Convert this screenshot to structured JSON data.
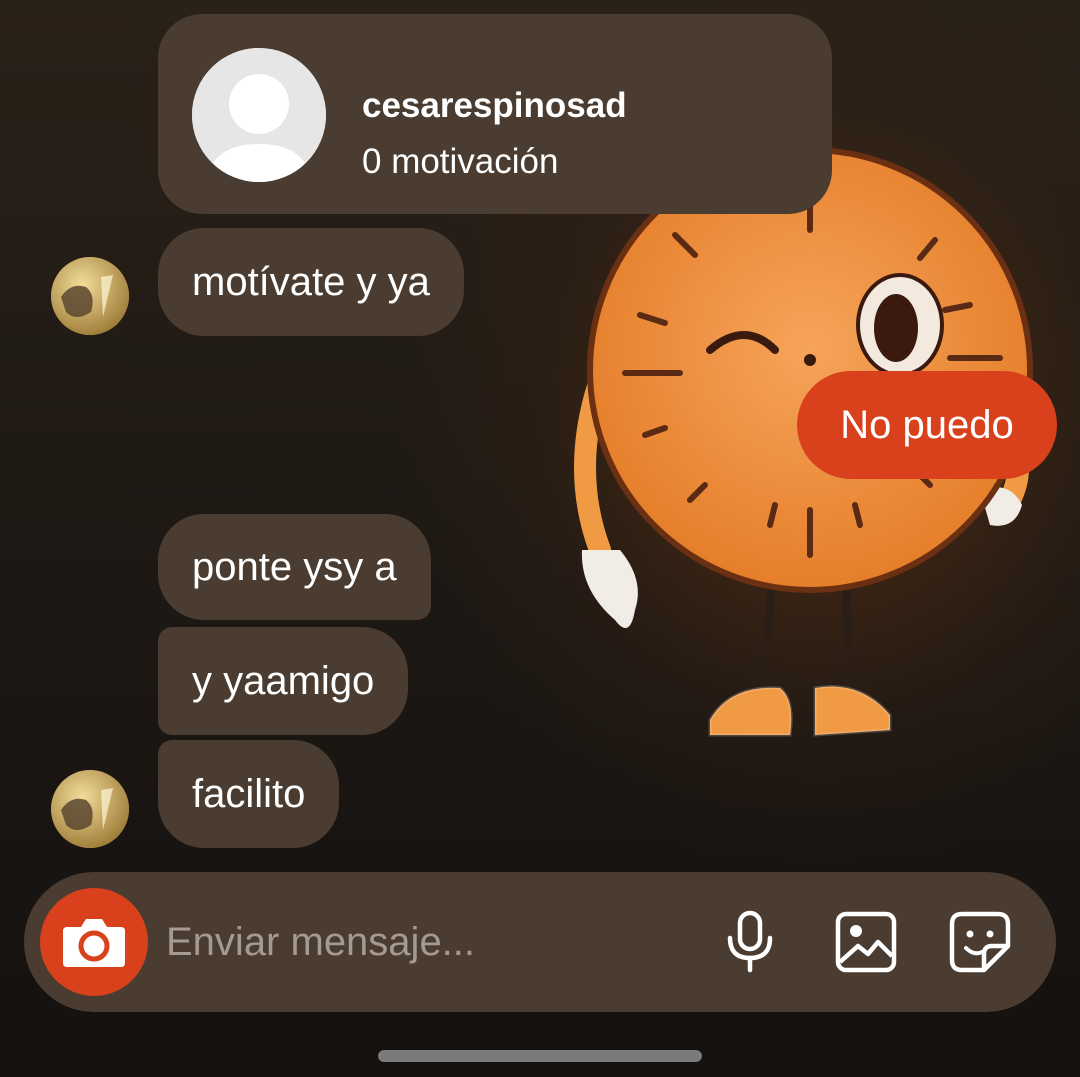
{
  "profile": {
    "username": "cesarespinosad",
    "subtitle": "0 motivación"
  },
  "messages": [
    {
      "text": "motívate y ya",
      "from": "other"
    },
    {
      "text": "No puedo",
      "from": "me"
    },
    {
      "text": "ponte ysy a",
      "from": "other"
    },
    {
      "text": "y yaamigo",
      "from": "other"
    },
    {
      "text": "facilito",
      "from": "other"
    }
  ],
  "composer": {
    "placeholder": "Enviar mensaje...",
    "icons": [
      "camera-icon",
      "microphone-icon",
      "gallery-icon",
      "sticker-icon"
    ]
  },
  "colors": {
    "accent": "#d9401c",
    "bubble": "#4a3c31",
    "background": "#1d1814"
  }
}
